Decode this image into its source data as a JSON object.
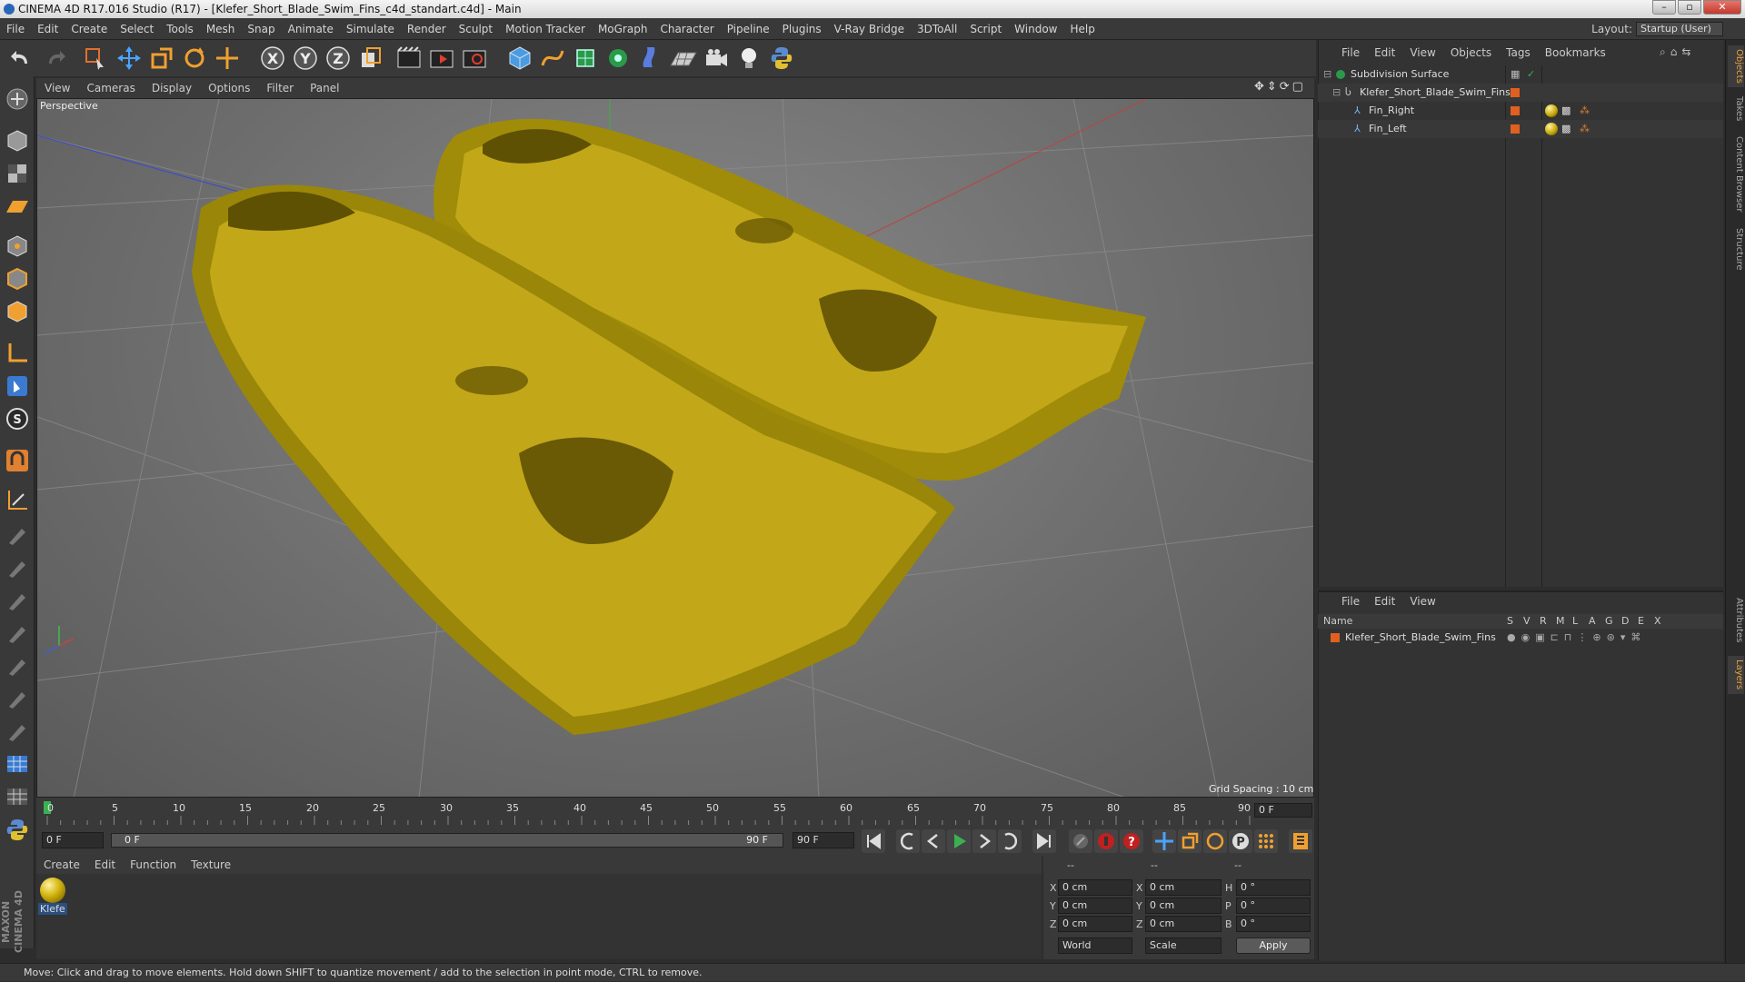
{
  "window": {
    "title": "CINEMA 4D R17.016 Studio (R17) - [Klefer_Short_Blade_Swim_Fins_c4d_standart.c4d] - Main"
  },
  "menu": [
    "File",
    "Edit",
    "Create",
    "Select",
    "Tools",
    "Mesh",
    "Snap",
    "Animate",
    "Simulate",
    "Render",
    "Sculpt",
    "Motion Tracker",
    "MoGraph",
    "Character",
    "Pipeline",
    "Plugins",
    "V-Ray Bridge",
    "3DToAll",
    "Script",
    "Window",
    "Help"
  ],
  "layout": {
    "label": "Layout:",
    "value": "Startup (User)"
  },
  "viewport": {
    "menu": [
      "View",
      "Cameras",
      "Display",
      "Options",
      "Filter",
      "Panel"
    ],
    "label": "Perspective",
    "grid_spacing": "Grid Spacing : 10 cm"
  },
  "timeline": {
    "ticks": [
      "0",
      "5",
      "10",
      "15",
      "20",
      "25",
      "30",
      "35",
      "40",
      "45",
      "50",
      "55",
      "60",
      "65",
      "70",
      "75",
      "80",
      "85",
      "90"
    ],
    "frame_end": "0 F"
  },
  "transport": {
    "current_frame": "0 F",
    "range_start": "0 F",
    "range_end": "90 F",
    "max_frame": "90 F"
  },
  "material_manager": {
    "menu": [
      "Create",
      "Edit",
      "Function",
      "Texture"
    ],
    "materials": [
      {
        "label": "Klefe"
      }
    ]
  },
  "coordinates": {
    "header": [
      "--",
      "--",
      "--"
    ],
    "rows": [
      {
        "a": "X",
        "av": "0 cm",
        "b": "X",
        "bv": "0 cm",
        "c": "H",
        "cv": "0 °"
      },
      {
        "a": "Y",
        "av": "0 cm",
        "b": "Y",
        "bv": "0 cm",
        "c": "P",
        "cv": "0 °"
      },
      {
        "a": "Z",
        "av": "0 cm",
        "b": "Z",
        "bv": "0 cm",
        "c": "B",
        "cv": "0 °"
      }
    ],
    "mode": "World",
    "transform": "Scale",
    "apply": "Apply"
  },
  "objects": {
    "menu": [
      "File",
      "Edit",
      "View",
      "Objects",
      "Tags",
      "Bookmarks"
    ],
    "items": [
      {
        "name": "Subdivision Surface"
      },
      {
        "name": "Klefer_Short_Blade_Swim_Fins"
      },
      {
        "name": "Fin_Right"
      },
      {
        "name": "Fin_Left"
      }
    ]
  },
  "layers": {
    "menu": [
      "File",
      "Edit",
      "View"
    ],
    "header_name": "Name",
    "columns": [
      "S",
      "V",
      "R",
      "M",
      "L",
      "A",
      "G",
      "D",
      "E",
      "X"
    ],
    "items": [
      {
        "name": "Klefer_Short_Blade_Swim_Fins"
      }
    ]
  },
  "right_tabs": [
    "Objects",
    "Takes",
    "Content Browser",
    "Structure",
    "Attributes",
    "Layers"
  ],
  "status": "Move: Click and drag to move elements. Hold down SHIFT to quantize movement / add to the selection in point mode, CTRL to remove.",
  "colors": {
    "accent": "#e8a040",
    "fin": "#b8a010",
    "layer_color": "#e06020"
  }
}
